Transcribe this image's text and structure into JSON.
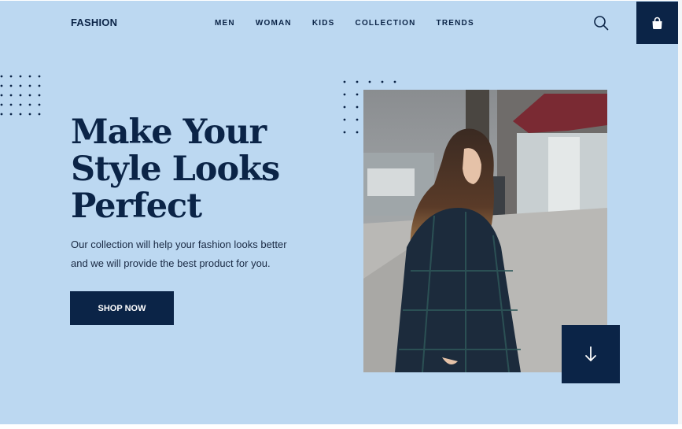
{
  "brand": "FASHION",
  "nav": [
    "MEN",
    "WOMAN",
    "KIDS",
    "COLLECTION",
    "TRENDS"
  ],
  "header_icons": {
    "search": "search-icon",
    "cart": "shopping-bag-icon"
  },
  "hero": {
    "headline_lines": [
      "Make Your",
      "Style Looks",
      "Perfect"
    ],
    "description_lines": [
      "Our collection will help your fashion looks better",
      "and we will provide the best product for you."
    ],
    "cta_label": "SHOP NOW",
    "scroll_icon": "arrow-down-icon"
  },
  "colors": {
    "background": "#bcd8f1",
    "primary": "#0b2447",
    "button_text": "#ffffff"
  }
}
